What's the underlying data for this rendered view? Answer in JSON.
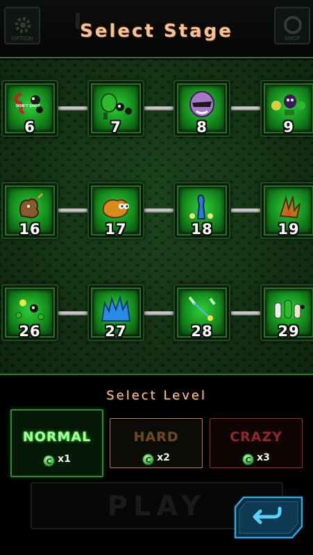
{
  "header": {
    "title": "Select Stage",
    "ghost_left_label": "OPTION",
    "ghost_right_label": "SHOP"
  },
  "stages": [
    {
      "number": "6",
      "art": "bean-dont-shoot",
      "art_text": "DON'T SHOT"
    },
    {
      "number": "7",
      "art": "green-pods"
    },
    {
      "number": "8",
      "art": "purple-mask"
    },
    {
      "number": "9",
      "art": "eggplant-group"
    },
    {
      "number": "16",
      "art": "brown-creature"
    },
    {
      "number": "17",
      "art": "orange-crab"
    },
    {
      "number": "18",
      "art": "blue-dinosaur"
    },
    {
      "number": "19",
      "art": "spiky-bug"
    },
    {
      "number": "26",
      "art": "tiny-green-gang"
    },
    {
      "number": "27",
      "art": "blue-cluster"
    },
    {
      "number": "28",
      "art": "laser-shooters"
    },
    {
      "number": "29",
      "art": "green-family"
    }
  ],
  "level": {
    "title": "Select Level",
    "options": [
      {
        "label": "NORMAL",
        "multiplier": "x1",
        "coin_symbol": "C",
        "selected": true,
        "color": "#2e8e2e"
      },
      {
        "label": "HARD",
        "multiplier": "x2",
        "coin_symbol": "C",
        "selected": false,
        "color": "#b0804a"
      },
      {
        "label": "CRAZY",
        "multiplier": "x3",
        "coin_symbol": "C",
        "selected": false,
        "color": "#a02a2a"
      }
    ]
  },
  "play_button": {
    "label": "PLAY",
    "enabled": false
  },
  "back_button": {
    "icon": "return-arrow-icon"
  },
  "colors": {
    "accent_green": "#2f7a2f",
    "title_orange": "#f2c49a",
    "back_cyan": "#2aa8e8"
  }
}
